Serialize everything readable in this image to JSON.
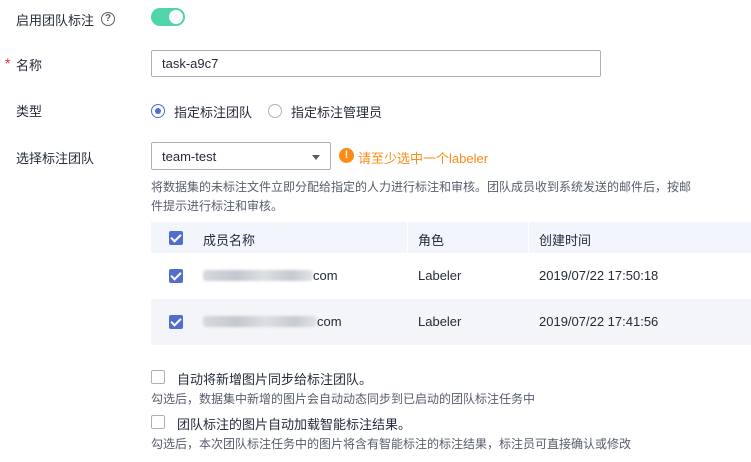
{
  "team_label": {
    "text": "启用团队标注",
    "help_icon": "question-circle-icon",
    "help_glyph": "?",
    "switch_on": true
  },
  "name": {
    "label": "名称",
    "required_mark": "*",
    "value": "task-a9c7"
  },
  "type": {
    "label": "类型",
    "options": [
      {
        "label": "指定标注团队",
        "selected": true
      },
      {
        "label": "指定标注管理员",
        "selected": false
      }
    ]
  },
  "team": {
    "label": "选择标注团队",
    "selected": "team-test",
    "warning_icon": "exclamation-circle-icon",
    "warning_glyph": "!",
    "warning": "请至少选中一个labeler",
    "description": "将数据集的未标注文件立即分配给指定的人力进行标注和审核。团队成员收到系统发送的邮件后，按邮件提示进行标注和审核。"
  },
  "members_table": {
    "columns": [
      "成员名称",
      "角色",
      "创建时间"
    ],
    "rows": [
      {
        "name_suffix": "com",
        "role": "Labeler",
        "created": "2019/07/22 17:50:18",
        "checked": true
      },
      {
        "name_suffix": "com",
        "role": "Labeler",
        "created": "2019/07/22 17:41:56",
        "checked": true
      }
    ]
  },
  "options": {
    "sync_new_images": {
      "label": "自动将新增图片同步给标注团队。",
      "note": "勾选后，数据集中新增的图片会自动动态同步到已启动的团队标注任务中",
      "checked": false
    },
    "auto_smart_results": {
      "label": "团队标注的图片自动加载智能标注结果。",
      "note": "勾选后，本次团队标注任务中的图片将含有智能标注的标注结果，标注员可直接确认或修改",
      "checked": false
    }
  },
  "colors": {
    "switch_on": "#50d4ab",
    "primary": "#526ecc",
    "warning": "#fa8c16",
    "required": "#f5222d",
    "table_header_bg": "#f2f5fc"
  }
}
